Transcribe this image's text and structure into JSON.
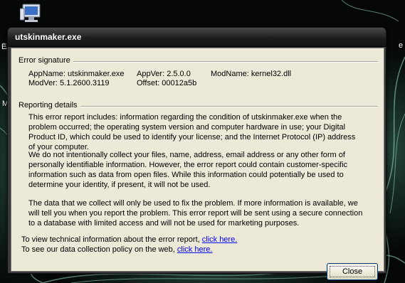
{
  "desktop": {
    "icon": "computer-monitor-icon",
    "fragment_left_1": "E",
    "fragment_left_2": "Me",
    "fragment_right": "e"
  },
  "window": {
    "title": "utskinmaker.exe",
    "error_signature": {
      "heading": "Error signature",
      "app_name": "AppName: utskinmaker.exe",
      "app_ver": "AppVer: 2.5.0.0",
      "mod_name": "ModName: kernel32.dll",
      "mod_ver": "ModVer: 5.1.2600.3119",
      "offset": "Offset: 00012a5b"
    },
    "reporting_details": {
      "heading": "Reporting details",
      "paragraphs": [
        "This error report includes: information regarding the condition of utskinmaker.exe when the problem occurred; the operating system version and computer hardware in use; your Digital Product ID, which could be used to identify your license; and the Internet Protocol (IP) address of your computer.",
        "We do not intentionally collect your files, name, address, email address or any other form of personally identifiable information. However, the error report could contain customer-specific information such as data from open files. While this information could potentially be used to determine your identity, if present, it will not be used.",
        "The data that we collect will only be used to fix the problem. If more information is available, we will tell you when you report the problem. This error report will be sent using a secure connection to a database with limited access and will not be used for marketing purposes."
      ]
    },
    "links": [
      {
        "text": "To view technical information about the error report,",
        "link": "click here."
      },
      {
        "text": "To see our data collection policy on the web,",
        "link": "click here."
      }
    ],
    "close_label": "Close"
  },
  "colors": {
    "dialog_background": "#ece9d8",
    "titlebar": "#1e1e1e",
    "link": "#0000ee"
  }
}
